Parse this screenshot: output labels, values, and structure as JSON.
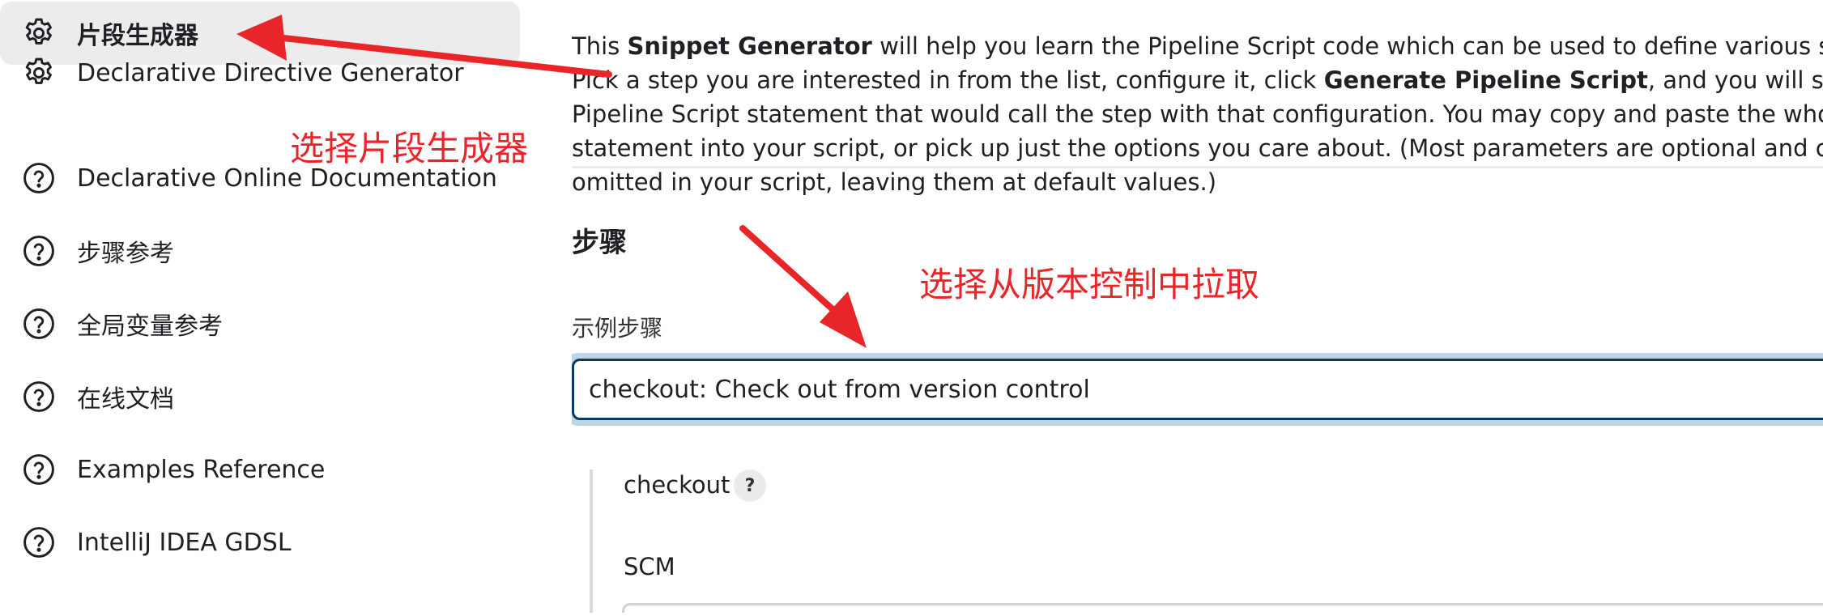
{
  "sidebar": {
    "items": [
      {
        "label": "片段生成器",
        "icon": "gear-icon",
        "active": true
      },
      {
        "label": "Declarative Directive Generator",
        "icon": "gear-icon"
      },
      {
        "label": "Declarative Online Documentation",
        "icon": "help-circle-icon"
      },
      {
        "label": "步骤参考",
        "icon": "help-circle-icon"
      },
      {
        "label": "全局变量参考",
        "icon": "help-circle-icon"
      },
      {
        "label": "在线文档",
        "icon": "help-circle-icon"
      },
      {
        "label": "Examples Reference",
        "icon": "help-circle-icon"
      },
      {
        "label": "IntelliJ IDEA GDSL",
        "icon": "help-circle-icon"
      }
    ]
  },
  "main": {
    "intro": {
      "p1": "This ",
      "b1": "Snippet Generator",
      "p2": " will help you learn the Pipeline Script code which can be used to define various steps. Pick a step you are interested in from the list, configure it, click ",
      "b2": "Generate Pipeline Script",
      "p3": ", and you will see a Pipeline Script statement that would call the step with that configuration. You may copy and paste the whole statement into your script, or pick up just the options you care about. (Most parameters are optional and can be omitted in your script, leaving them at default values.)"
    },
    "section_title": "步骤",
    "field_label": "示例步骤",
    "selected_step": "checkout: Check out from version control",
    "step_name": "checkout",
    "help_label": "?",
    "scm_label": "SCM"
  },
  "annotations": {
    "note1": "选择片段生成器",
    "note2": "选择从版本控制中拉取",
    "color": "#e8262a"
  }
}
